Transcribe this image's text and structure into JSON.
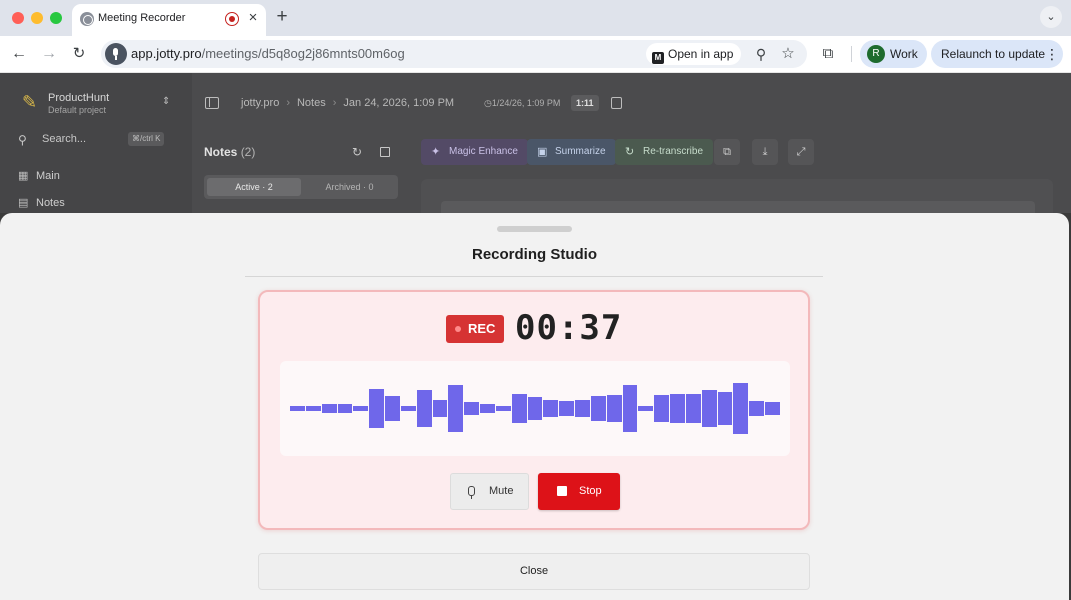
{
  "browser": {
    "tab_title": "Meeting Recorder",
    "url_host": "app.jotty.pro",
    "url_path": "/meetings/d5q8og2j86mnts00m6og",
    "open_in_app_label": "Open in app",
    "open_in_app_icon_text": "M",
    "profile_initial": "R",
    "profile_name": "Work",
    "relaunch_label": "Relaunch to update"
  },
  "sidebar": {
    "project_name": "ProductHunt",
    "project_subtitle": "Default project",
    "search_label": "Search...",
    "search_shortcut": "⌘/ctrl  K",
    "items": [
      {
        "label": "Main",
        "icon": "map-icon"
      },
      {
        "label": "Notes",
        "icon": "notes-icon"
      }
    ]
  },
  "header": {
    "breadcrumb": [
      "jotty.pro",
      "Notes",
      "Jan 24, 2026, 1:09 PM"
    ],
    "meta_date": "1/24/26, 1:09 PM",
    "meta_duration": "1:11"
  },
  "notes_panel": {
    "title": "Notes",
    "count": "(2)",
    "segment_active": "Active · 2",
    "segment_archived": "Archived · 0"
  },
  "actions": {
    "magic_enhance": "Magic Enhance",
    "summarize": "Summarize",
    "retranscribe": "Re-transcribe"
  },
  "sheet": {
    "title": "Recording Studio",
    "rec_badge": "REC",
    "timer": "00:37",
    "mute_label": "Mute",
    "stop_label": "Stop",
    "close_label": "Close"
  },
  "waveform": {
    "levels": [
      0.06,
      0.06,
      0.1,
      0.1,
      0.06,
      0.42,
      0.26,
      0.06,
      0.38,
      0.18,
      0.5,
      0.14,
      0.1,
      0.06,
      0.3,
      0.24,
      0.18,
      0.16,
      0.18,
      0.26,
      0.28,
      0.5,
      0.06,
      0.28,
      0.3,
      0.3,
      0.38,
      0.34,
      0.54,
      0.16,
      0.14
    ],
    "color": "#6f67ea"
  },
  "colors": {
    "record_red": "#d63333",
    "stop_red": "#dd1218",
    "card_border": "#f3b9bb"
  }
}
